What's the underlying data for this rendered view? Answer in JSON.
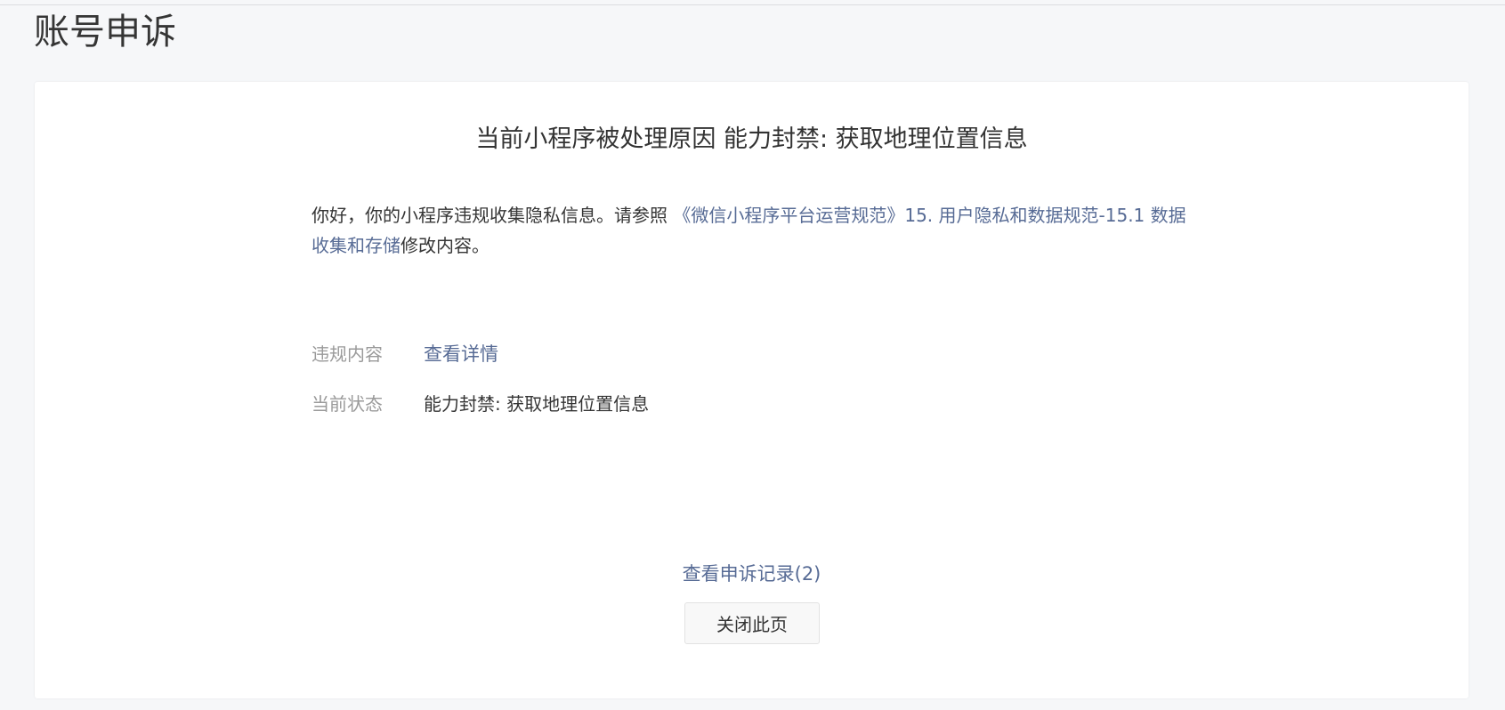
{
  "header": {
    "page_title": "账号申诉"
  },
  "card": {
    "reason_title": "当前小程序被处理原因 能力封禁: 获取地理位置信息",
    "notice": {
      "prefix": "你好，你的小程序违规收集隐私信息。请参照 ",
      "link_text": "《微信小程序平台运营规范》15. 用户隐私和数据规范-15.1 数据收集和存储",
      "suffix": "修改内容。"
    },
    "violation": {
      "label": "违规内容",
      "link": "查看详情"
    },
    "status": {
      "label": "当前状态",
      "value": "能力封禁: 获取地理位置信息"
    },
    "history_link": "查看申诉记录(2)",
    "close_button": "关闭此页"
  },
  "colors": {
    "link": "#576b95",
    "label": "#9a9a9a",
    "text": "#353535",
    "background": "#f6f7f9"
  }
}
